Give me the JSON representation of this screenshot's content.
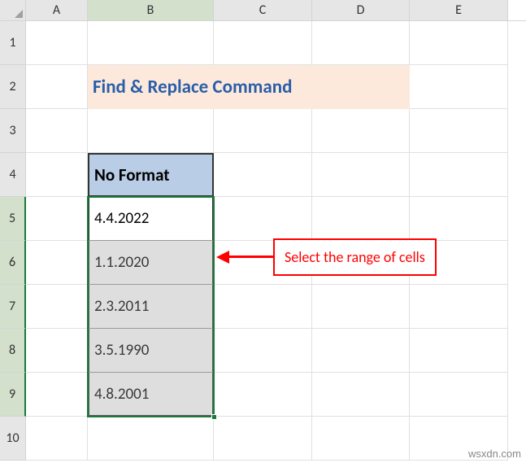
{
  "columns": {
    "A": "A",
    "B": "B",
    "C": "C",
    "D": "D",
    "E": "E"
  },
  "rows": {
    "r1": "1",
    "r2": "2",
    "r3": "3",
    "r4": "4",
    "r5": "5",
    "r6": "6",
    "r7": "7",
    "r8": "8",
    "r9": "9",
    "r10": "10"
  },
  "title": "Find & Replace Command",
  "header": "No Format",
  "data": [
    "4.4.2022",
    "1.1.2020",
    "2.3.2011",
    "3.5.1990",
    "4.8.2001"
  ],
  "callout": "Select the range of cells",
  "watermark": "wsxdn.com",
  "chart_data": {
    "type": "table",
    "title": "No Format",
    "columns": [
      "No Format"
    ],
    "rows": [
      [
        "4.4.2022"
      ],
      [
        "1.1.2020"
      ],
      [
        "2.3.2011"
      ],
      [
        "3.5.1990"
      ],
      [
        "4.8.2001"
      ]
    ]
  }
}
